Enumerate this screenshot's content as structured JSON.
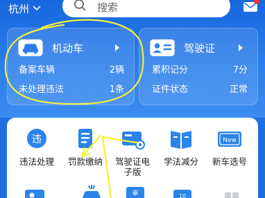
{
  "topbar": {
    "city": "杭州",
    "search_placeholder": "搜索"
  },
  "vehicle_card": {
    "title": "机动车",
    "rows": [
      {
        "label": "备案车辆",
        "value": "2辆"
      },
      {
        "label": "未处理违法",
        "value": "1条"
      }
    ]
  },
  "license_card": {
    "title": "驾驶证",
    "rows": [
      {
        "label": "累积记分",
        "value": "7分"
      },
      {
        "label": "证件状态",
        "value": "正常"
      }
    ]
  },
  "services": [
    {
      "label": "违法处理",
      "icon": "violation-icon",
      "glyph": "违"
    },
    {
      "label": "罚款缴纳",
      "icon": "fine-payment-icon"
    },
    {
      "label_line1": "驾驶证电",
      "label_line2": "子版",
      "icon": "e-license-icon"
    },
    {
      "label": "学法减分",
      "icon": "study-book-icon"
    },
    {
      "label": "新车选号",
      "icon": "new-plate-icon",
      "glyph": "New"
    }
  ],
  "row2_glyphs": {
    "a": "审",
    "b": "10"
  },
  "colors": {
    "brand_blue": "#1f6fe0",
    "icon_blue": "#2b84ea",
    "annotation_yellow": "#f7f03a"
  }
}
